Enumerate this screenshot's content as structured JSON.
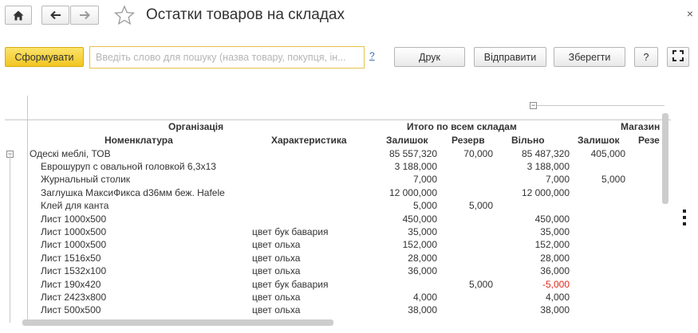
{
  "window": {
    "title": "Остатки товаров на складах",
    "close_glyph": "×"
  },
  "toolbar": {
    "generate_label": "Сформувати",
    "search_placeholder": "Введіть слово для пошуку (назва товару, покупця, ін...",
    "help_label": "?",
    "print_label": "Друк",
    "send_label": "Відправити",
    "save_label": "Зберегти",
    "help_button_label": "?"
  },
  "report": {
    "headers": {
      "organization": "Організація",
      "nomenclature": "Номенклатура",
      "characteristic": "Характеристика",
      "total_all_warehouses": "Итого по всем складам",
      "balance": "Залишок",
      "reserve": "Резерв",
      "free": "Вільно",
      "store": "Магазин",
      "store_balance": "Залишок",
      "store_reserve": "Резе"
    },
    "group": {
      "name": "Одескі меблі, ТОВ",
      "balance": "85 557,320",
      "reserve": "70,000",
      "free": "85 487,320",
      "store_balance": "405,000"
    },
    "rows": [
      {
        "name": "Еврошуруп с овальной головкой 6,3х13",
        "char": "",
        "balance": "3 188,000",
        "reserve": "",
        "free": "3 188,000",
        "store_balance": ""
      },
      {
        "name": "Журнальный столик",
        "char": "",
        "balance": "7,000",
        "reserve": "",
        "free": "7,000",
        "store_balance": "5,000"
      },
      {
        "name": "Заглушка МаксиФикса d36мм беж. Hafele",
        "char": "",
        "balance": "12 000,000",
        "reserve": "",
        "free": "12 000,000",
        "store_balance": ""
      },
      {
        "name": "Клей для канта",
        "char": "",
        "balance": "5,000",
        "reserve": "5,000",
        "free": "",
        "store_balance": ""
      },
      {
        "name": "Лист 1000х500",
        "char": "",
        "balance": "450,000",
        "reserve": "",
        "free": "450,000",
        "store_balance": ""
      },
      {
        "name": "Лист 1000х500",
        "char": "цвет бук бавария",
        "balance": "35,000",
        "reserve": "",
        "free": "35,000",
        "store_balance": ""
      },
      {
        "name": "Лист 1000х500",
        "char": "цвет ольха",
        "balance": "152,000",
        "reserve": "",
        "free": "152,000",
        "store_balance": ""
      },
      {
        "name": "Лист 1516х50",
        "char": "цвет ольха",
        "balance": "28,000",
        "reserve": "",
        "free": "28,000",
        "store_balance": ""
      },
      {
        "name": "Лист 1532х100",
        "char": "цвет ольха",
        "balance": "36,000",
        "reserve": "",
        "free": "36,000",
        "store_balance": ""
      },
      {
        "name": "Лист 190х420",
        "char": "цвет бук бавария",
        "balance": "",
        "reserve": "5,000",
        "free": "-5,000",
        "store_balance": "",
        "negative": true
      },
      {
        "name": "Лист 2423х800",
        "char": "цвет ольха",
        "balance": "4,000",
        "reserve": "",
        "free": "4,000",
        "store_balance": ""
      },
      {
        "name": "Лист 500х500",
        "char": "цвет ольха",
        "balance": "38,000",
        "reserve": "",
        "free": "38,000",
        "store_balance": ""
      }
    ]
  },
  "colors": {
    "primary_button": "#f6d13a",
    "negative_value": "#e0271b",
    "link": "#3b6fb5"
  },
  "icons": {
    "home": "home-icon",
    "back": "arrow-left-icon",
    "forward": "arrow-right-icon",
    "favorite": "star-icon",
    "fullscreen": "expand-icon",
    "more": "vertical-dots-icon"
  }
}
